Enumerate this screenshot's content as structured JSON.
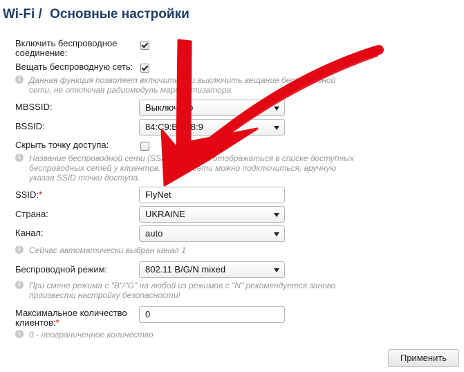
{
  "header": {
    "section": "Wi-Fi",
    "separator": "/",
    "title": "Основные настройки"
  },
  "fields": {
    "enable_wireless": {
      "label": "Включить беспроводное соединение:",
      "checked": true
    },
    "broadcast": {
      "label": "Вещать беспроводную сеть:",
      "checked": true,
      "hint": "Данная функция позволяет включить или выключить вещание беспроводной сети, не отключая радиомодуль маршрутизатора."
    },
    "mbssid": {
      "label": "MBSSID:",
      "value": "Выключено"
    },
    "bssid": {
      "label": "BSSID:",
      "value": "84:C9:B2:F8:9"
    },
    "hide_ap": {
      "label": "Скрыть точку доступа:",
      "checked": false,
      "hint": "Название беспроводной сети (SSID) не будет отображаться в списке доступных беспроводных сетей у клиентов. К этой сети можно подключиться, вручную указав SSID точки доступа."
    },
    "ssid": {
      "label": "SSID:",
      "required_mark": "*",
      "value": "FlyNet"
    },
    "country": {
      "label": "Страна:",
      "value": "UKRAINE"
    },
    "channel": {
      "label": "Канал:",
      "value": "auto",
      "hint": "Сейчас автоматически выбран канал 1"
    },
    "mode": {
      "label": "Беспроводной режим:",
      "value": "802.11 B/G/N mixed",
      "hint": "При смене режима с \"B\"/\"G\" на любой из режимов с \"N\" рекомендуется заново произвести настройку безопасности!"
    },
    "max_clients": {
      "label": "Максимальное количество клиентов:",
      "required_mark": "*",
      "value": "0",
      "hint": "0 - неограниченное количество"
    }
  },
  "buttons": {
    "apply": "Применить"
  },
  "icons": {
    "info": "info-icon",
    "checkbox_check": "check-icon",
    "dropdown": "chevron-down-icon"
  },
  "colors": {
    "title": "#1d3d66",
    "arrow": "#e30613",
    "required": "#dd0000",
    "hint": "#999999"
  }
}
